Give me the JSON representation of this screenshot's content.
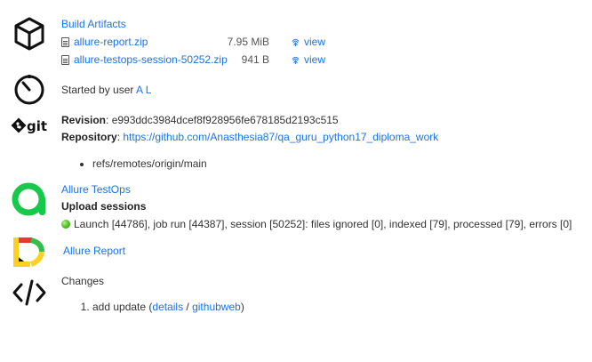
{
  "artifacts": {
    "title": "Build Artifacts",
    "files": [
      {
        "name": "allure-report.zip",
        "size": "7.95 MiB",
        "view_label": "view"
      },
      {
        "name": "allure-testops-session-50252.zip",
        "size": "941 B",
        "view_label": "view"
      }
    ]
  },
  "started": {
    "prefix": "Started by user ",
    "user": "A L"
  },
  "git": {
    "logo_text": "git",
    "revision_label": "Revision",
    "revision_sep": ": ",
    "revision_value": "e993ddc3984dcef8f928956fe678185d2193c515",
    "repository_label": "Repository",
    "repository_sep": ": ",
    "repository_url": "https://github.com/Anasthesia87/qa_guru_python17_diploma_work",
    "branches": [
      "refs/remotes/origin/main"
    ]
  },
  "testops": {
    "title": "Allure TestOps",
    "upload_heading": "Upload sessions",
    "status_text": "Launch [44786], job run [44387], session [50252]: files ignored [0], indexed [79], processed [79], errors [0]",
    "status_color": "#5cc72a"
  },
  "report": {
    "title": "Allure Report"
  },
  "changes": {
    "title": "Changes",
    "items": [
      {
        "text": "add update (",
        "details_label": "details",
        "sep": " / ",
        "githubweb_label": "githubweb",
        "suffix": ")"
      }
    ]
  },
  "colors": {
    "link": "#1a73e8",
    "testops_green": "#18c84a",
    "report_yellow": "#ffd020",
    "report_red": "#e53935",
    "report_green": "#2fbf4a"
  }
}
